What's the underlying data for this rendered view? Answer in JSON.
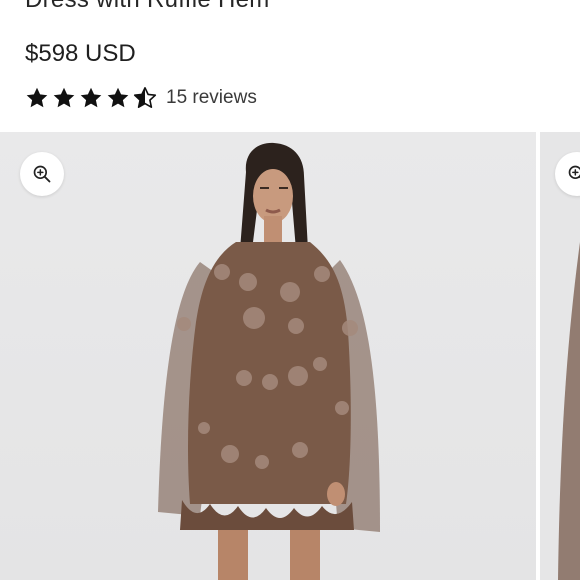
{
  "product": {
    "title": "Dress with Ruffle Hem",
    "price": "$598 USD",
    "rating": {
      "value": 4.5,
      "max": 5
    },
    "reviews_label": "15 reviews"
  },
  "gallery": {
    "zoom_icon": "zoom-in-icon",
    "colors": {
      "background": "#e8e8e9",
      "dress": "#7a5a48"
    }
  }
}
